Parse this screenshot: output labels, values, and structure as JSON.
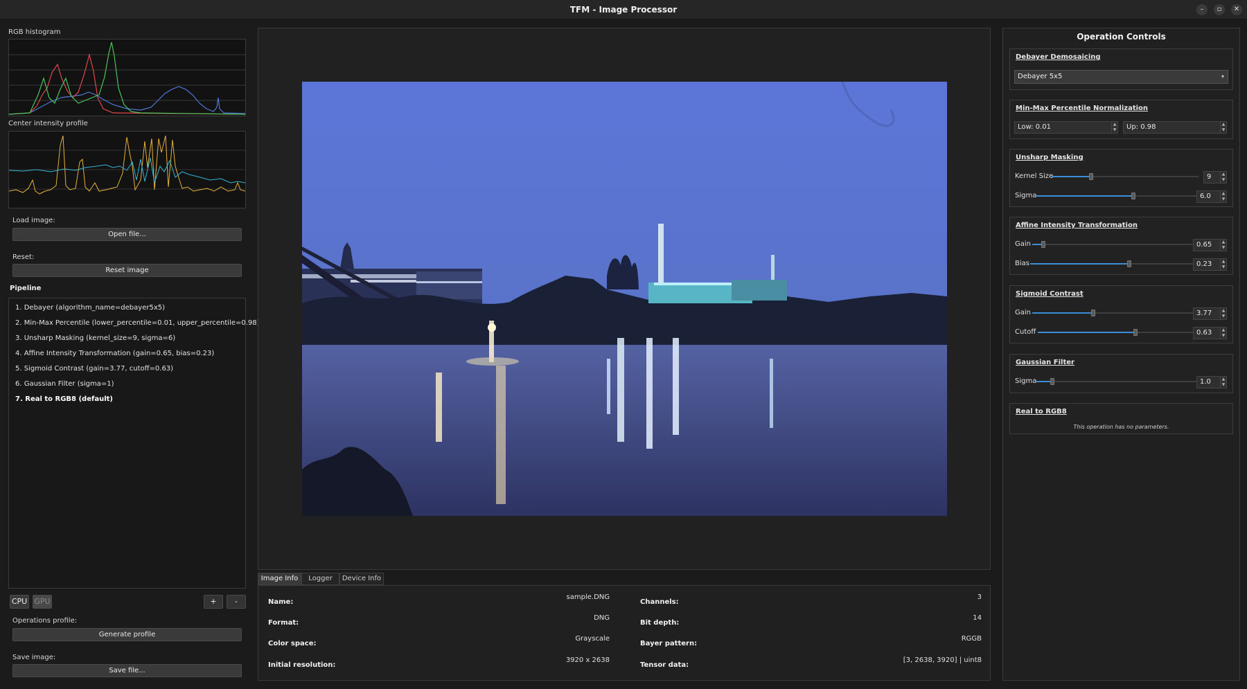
{
  "window": {
    "title": "TFM - Image Processor",
    "controls": [
      "minimize-icon",
      "maximize-icon",
      "close-icon"
    ]
  },
  "left": {
    "histogram_label": "RGB histogram",
    "profile_label": "Center intensity profile",
    "load_label": "Load image:",
    "open_button": "Open file...",
    "reset_label": "Reset:",
    "reset_button": "Reset image",
    "pipeline_label": "Pipeline",
    "pipeline": [
      "1. Debayer (algorithm_name=debayer5x5)",
      "2. Min-Max Percentile (lower_percentile=0.01, upper_percentile=0.98)",
      "3. Unsharp Masking (kernel_size=9, sigma=6)",
      "4. Affine Intensity Transformation (gain=0.65, bias=0.23)",
      "5. Sigmoid Contrast (gain=3.77, cutoff=0.63)",
      "6. Gaussian Filter (sigma=1)",
      "7. Real to RGB8 (default)"
    ],
    "selected_index": 6,
    "cpu_label": "CPU",
    "gpu_label": "GPU",
    "add_label": "+",
    "remove_label": "-",
    "ops_profile_label": "Operations profile:",
    "generate_button": "Generate profile",
    "save_label": "Save image:",
    "save_button": "Save file..."
  },
  "tabs": [
    "Image Info",
    "Logger",
    "Device Info"
  ],
  "active_tab": "Image Info",
  "image_info": {
    "name_label": "Name:",
    "name": "sample.DNG",
    "format_label": "Format:",
    "format": "DNG",
    "colorspace_label": "Color space:",
    "colorspace": "Grayscale",
    "resolution_label": "Initial resolution:",
    "resolution": "3920 x 2638",
    "channels_label": "Channels:",
    "channels": "3",
    "bitdepth_label": "Bit depth:",
    "bitdepth": "14",
    "bayer_label": "Bayer pattern:",
    "bayer": "RGGB",
    "tensor_label": "Tensor data:",
    "tensor": "[3, 2638, 3920] | uint8"
  },
  "controls": {
    "title": "Operation Controls",
    "debayer": {
      "title": "Debayer Demosaicing",
      "value": "Debayer 5x5"
    },
    "minmax": {
      "title": "Min-Max Percentile Normalization",
      "low": "Low: 0.01",
      "up": "Up: 0.98"
    },
    "unsharp": {
      "title": "Unsharp Masking",
      "kernel_label": "Kernel Size",
      "kernel": "9",
      "kernel_level": 0.27,
      "sigma_label": "Sigma",
      "sigma": "6.0",
      "sigma_level": 0.6
    },
    "affine": {
      "title": "Affine Intensity Transformation",
      "gain_label": "Gain",
      "gain": "0.65",
      "gain_level": 0.07,
      "bias_label": "Bias",
      "bias": "0.23",
      "bias_level": 0.61
    },
    "sigmoid": {
      "title": "Sigmoid Contrast",
      "gain_label": "Gain",
      "gain": "3.77",
      "gain_level": 0.38,
      "cutoff_label": "Cutoff",
      "cutoff": "0.63",
      "cutoff_level": 0.63
    },
    "gaussian": {
      "title": "Gaussian Filter",
      "sigma_label": "Sigma",
      "sigma": "1.0",
      "sigma_level": 0.1
    },
    "rgb8": {
      "title": "Real to RGB8",
      "note": "This operation has no parameters."
    }
  },
  "colors": {
    "accent": "#3b8fd9",
    "hist_red": "#e0484d",
    "hist_green": "#49c45a",
    "hist_blue": "#4f78d8",
    "profile_yellow": "#e8b23a",
    "profile_cyan": "#35b6d6"
  }
}
